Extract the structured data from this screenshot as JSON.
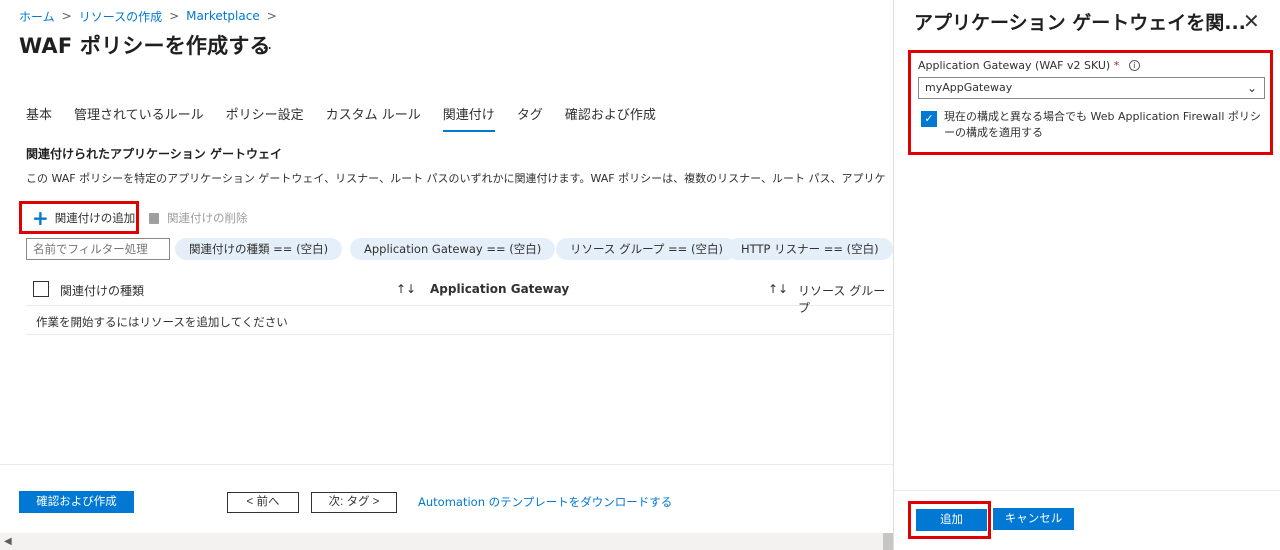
{
  "breadcrumb": {
    "items": [
      "ホーム",
      "リソースの作成",
      "Marketplace"
    ],
    "separator": ">"
  },
  "page": {
    "title": "WAF ポリシーを作成する",
    "more": "..."
  },
  "tabs": [
    {
      "label": "基本"
    },
    {
      "label": "管理されているルール"
    },
    {
      "label": "ポリシー設定"
    },
    {
      "label": "カスタム ルール"
    },
    {
      "label": "関連付け",
      "active": true
    },
    {
      "label": "タグ"
    },
    {
      "label": "確認および作成"
    }
  ],
  "section": {
    "title": "関連付けられたアプリケーション ゲートウェイ",
    "description": "この WAF ポリシーを特定のアプリケーション ゲートウェイ、リスナー、ルート パスのいずれかに関連付けます。WAF ポリシーは、複数のリスナー、ルート パス、アプリケーション ゲートウェイに関連付"
  },
  "toolbar": {
    "add_label": "関連付けの追加",
    "delete_label": "関連付けの削除"
  },
  "filter": {
    "placeholder": "名前でフィルター処理",
    "pills": [
      "関連付けの種類 == (空白)",
      "Application Gateway == (空白)",
      "リソース グループ == (空白)",
      "HTTP リスナー == (空白)"
    ]
  },
  "grid": {
    "columns": [
      "関連付けの種類",
      "Application Gateway",
      "リソース グループ"
    ],
    "sort_icon": "↑↓",
    "empty_message": "作業を開始するにはリソースを追加してください"
  },
  "footer": {
    "review_label": "確認および作成",
    "prev_label": "< 前へ",
    "next_label": "次: タグ >",
    "template_link": "Automation のテンプレートをダウンロードする"
  },
  "panel": {
    "title": "アプリケーション ゲートウェイを関...",
    "close": "✕",
    "field_label": "Application Gateway (WAF v2 SKU)",
    "required_mark": "*",
    "info_icon": "i",
    "selected_gateway": "myAppGateway",
    "apply_label": "現在の構成と異なる場合でも Web Application Firewall ポリシーの構成を適用する",
    "apply_checked": true,
    "add_label": "追加",
    "cancel_label": "キャンセル"
  },
  "colors": {
    "accent": "#0078d4",
    "highlight_border": "#e00000",
    "pill_background": "#e5eff9"
  }
}
